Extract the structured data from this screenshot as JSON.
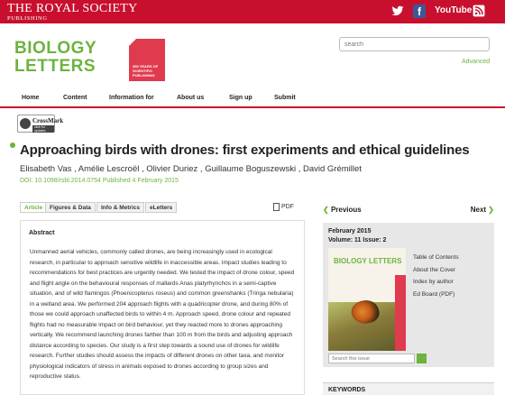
{
  "brand": {
    "line1": "THE ROYAL SOCIETY",
    "line2": "PUBLISHING"
  },
  "social": {
    "youtube": "YouTube",
    "facebook": "f"
  },
  "header": {
    "journal_line1": "BIOLOGY",
    "journal_line2": "LETTERS",
    "anniversary_badge": "350 YEARS OF SCIENTIFIC PUBLISHING",
    "search_placeholder": "search",
    "advanced_label": "Advanced"
  },
  "nav": {
    "items": [
      "Home",
      "Content",
      "Information for",
      "About us",
      "Sign up",
      "Submit"
    ]
  },
  "crossmark": {
    "label": "CrossMark",
    "sub": "click for updates"
  },
  "article": {
    "title": "Approaching birds with drones: first experiments and ethical guidelines",
    "authors": "Elisabeth Vas , Amélie Lescroël , Olivier Duriez , Guillaume Boguszewski , David Grémillet",
    "doi_line": "DOI: 10.1098/rsbl.2014.0754   Published 4 February 2015"
  },
  "tabs": [
    "Article",
    "Figures & Data",
    "Info & Metrics",
    "eLetters"
  ],
  "pdf_label": "PDF",
  "abstract": {
    "heading": "Abstract",
    "text": "Unmanned aerial vehicles, commonly called drones, are being increasingly used in ecological research, in particular to approach sensitive wildlife in inaccessible areas. Impact studies leading to recommendations for best practices are urgently needed. We tested the impact of drone colour, speed and flight angle on the behavioural responses of mallards Anas platyrhynchos in a semi-captive situation, and of wild flamingos (Phoenicopterus roseus) and common greenshanks (Tringa nebularia) in a wetland area. We performed 204 approach flights with a quadricopter drone, and during 80% of those we could approach unaffected birds to within 4 m. Approach speed, drone colour and repeated flights had no measurable impact on bird behaviour, yet they reacted more to drones approaching vertically. We recommend launching drones farther than 100 m from the birds and adjusting approach distance according to species. Our study is a first step towards a sound use of drones for wildlife research. Further studies should assess the impacts of different drones on other taxa, and monitor physiological indicators of stress in animals exposed to drones according to group sizes and reproductive status."
  },
  "sidebar": {
    "prev_label": "Previous",
    "next_label": "Next",
    "issue_date": "February 2015",
    "issue_volume": "Volume: 11 Issue: 2",
    "cover_title": "BIOLOGY LETTERS",
    "links": [
      "Table of Contents",
      "About the Cover",
      "Index by author",
      "Ed Board (PDF)"
    ],
    "issue_search_placeholder": "Search this issue",
    "keywords_heading": "KEYWORDS"
  },
  "colors": {
    "brand_red": "#c8102e",
    "accent_green": "#6db33f"
  }
}
